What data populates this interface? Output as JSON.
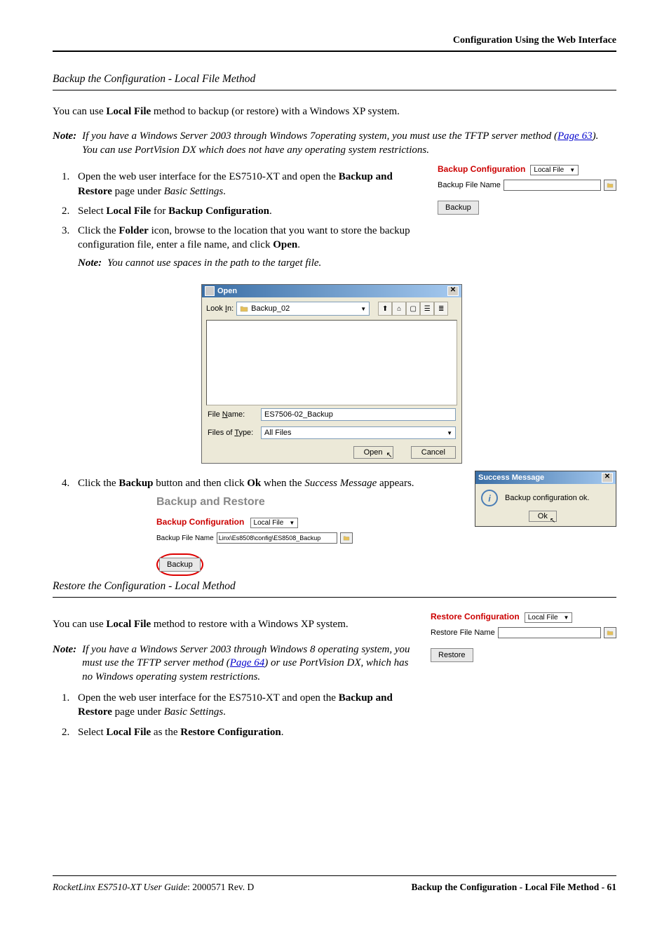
{
  "header": {
    "right": "Configuration Using the Web Interface"
  },
  "section1": {
    "title": "Backup the Configuration - Local File Method",
    "intro_pre": "You can use ",
    "intro_bold": "Local File",
    "intro_post": " method to backup (or restore) with a Windows XP system.",
    "note_label": "Note:",
    "note": "If you have a Windows Server 2003 through Windows 7operating system, you must use the TFTP server method (",
    "note_link": "Page 63",
    "note_after": "). You can use PortVision DX which does not have any operating system restrictions.",
    "steps": {
      "s1_a": "Open the web user interface for the ES7510-XT and open the ",
      "s1_b": "Backup and Restore",
      "s1_c": " page under ",
      "s1_d": "Basic Settings",
      "s1_e": ".",
      "s2_a": "Select ",
      "s2_b": "Local File",
      "s2_c": " for ",
      "s2_d": "Backup Configuration",
      "s2_e": ".",
      "s3_a": "Click the ",
      "s3_b": "Folder",
      "s3_c": " icon, browse to the location that you want to store the backup configuration file, enter a file name, and click ",
      "s3_d": "Open",
      "s3_e": ".",
      "s3_note_label": "Note:",
      "s3_note": "You cannot use spaces in the path to the target file.",
      "s4_a": "Click the ",
      "s4_b": "Backup",
      "s4_c": " button and then click ",
      "s4_d": "Ok",
      "s4_e": " when the ",
      "s4_f": "Success Message",
      "s4_g": " appears."
    }
  },
  "backup_panel": {
    "title": "Backup Configuration",
    "select_value": "Local File",
    "file_label": "Backup File Name",
    "button": "Backup"
  },
  "open_dialog": {
    "title": "Open",
    "look_in_label": "Look In:",
    "look_in_value": "Backup_02",
    "file_name_label": "File Name:",
    "file_name_value": "ES7506-02_Backup",
    "files_type_label": "Files of Type:",
    "files_type_value": "All Files",
    "open_btn": "Open",
    "cancel_btn": "Cancel"
  },
  "bar_panel": {
    "heading": "Backup and Restore",
    "title": "Backup Configuration",
    "select_value": "Local File",
    "file_label": "Backup File Name",
    "file_value": "Linx\\Es8508\\config\\ES8508_Backup",
    "button": "Backup"
  },
  "success_msg": {
    "title": "Success Message",
    "body": "Backup configuration ok.",
    "ok": "Ok"
  },
  "section2": {
    "title": "Restore the Configuration - Local Method",
    "intro_pre": "You can use ",
    "intro_bold": "Local File",
    "intro_post": " method to restore with a Windows XP system.",
    "note_label": "Note:",
    "note_a": "If you have a Windows Server 2003 through Windows 8 operating system, you must use the TFTP server method (",
    "note_link": "Page 64",
    "note_b": ") or use PortVision DX, which has no Windows operating system restrictions.",
    "steps": {
      "s1_a": "Open the web user interface for the ES7510-XT and open the ",
      "s1_b": "Backup and Restore",
      "s1_c": " page under ",
      "s1_d": "Basic Settings",
      "s1_e": ".",
      "s2_a": "Select ",
      "s2_b": "Local File",
      "s2_c": " as the ",
      "s2_d": "Restore Configuration",
      "s2_e": "."
    }
  },
  "restore_panel": {
    "title": "Restore Configuration",
    "select_value": "Local File",
    "file_label": "Restore File Name",
    "button": "Restore"
  },
  "footer": {
    "left_italic": "RocketLinx ES7510-XT  User Guide",
    "left_rest": ": 2000571 Rev. D",
    "right": "Backup the Configuration - Local File Method - 61"
  }
}
